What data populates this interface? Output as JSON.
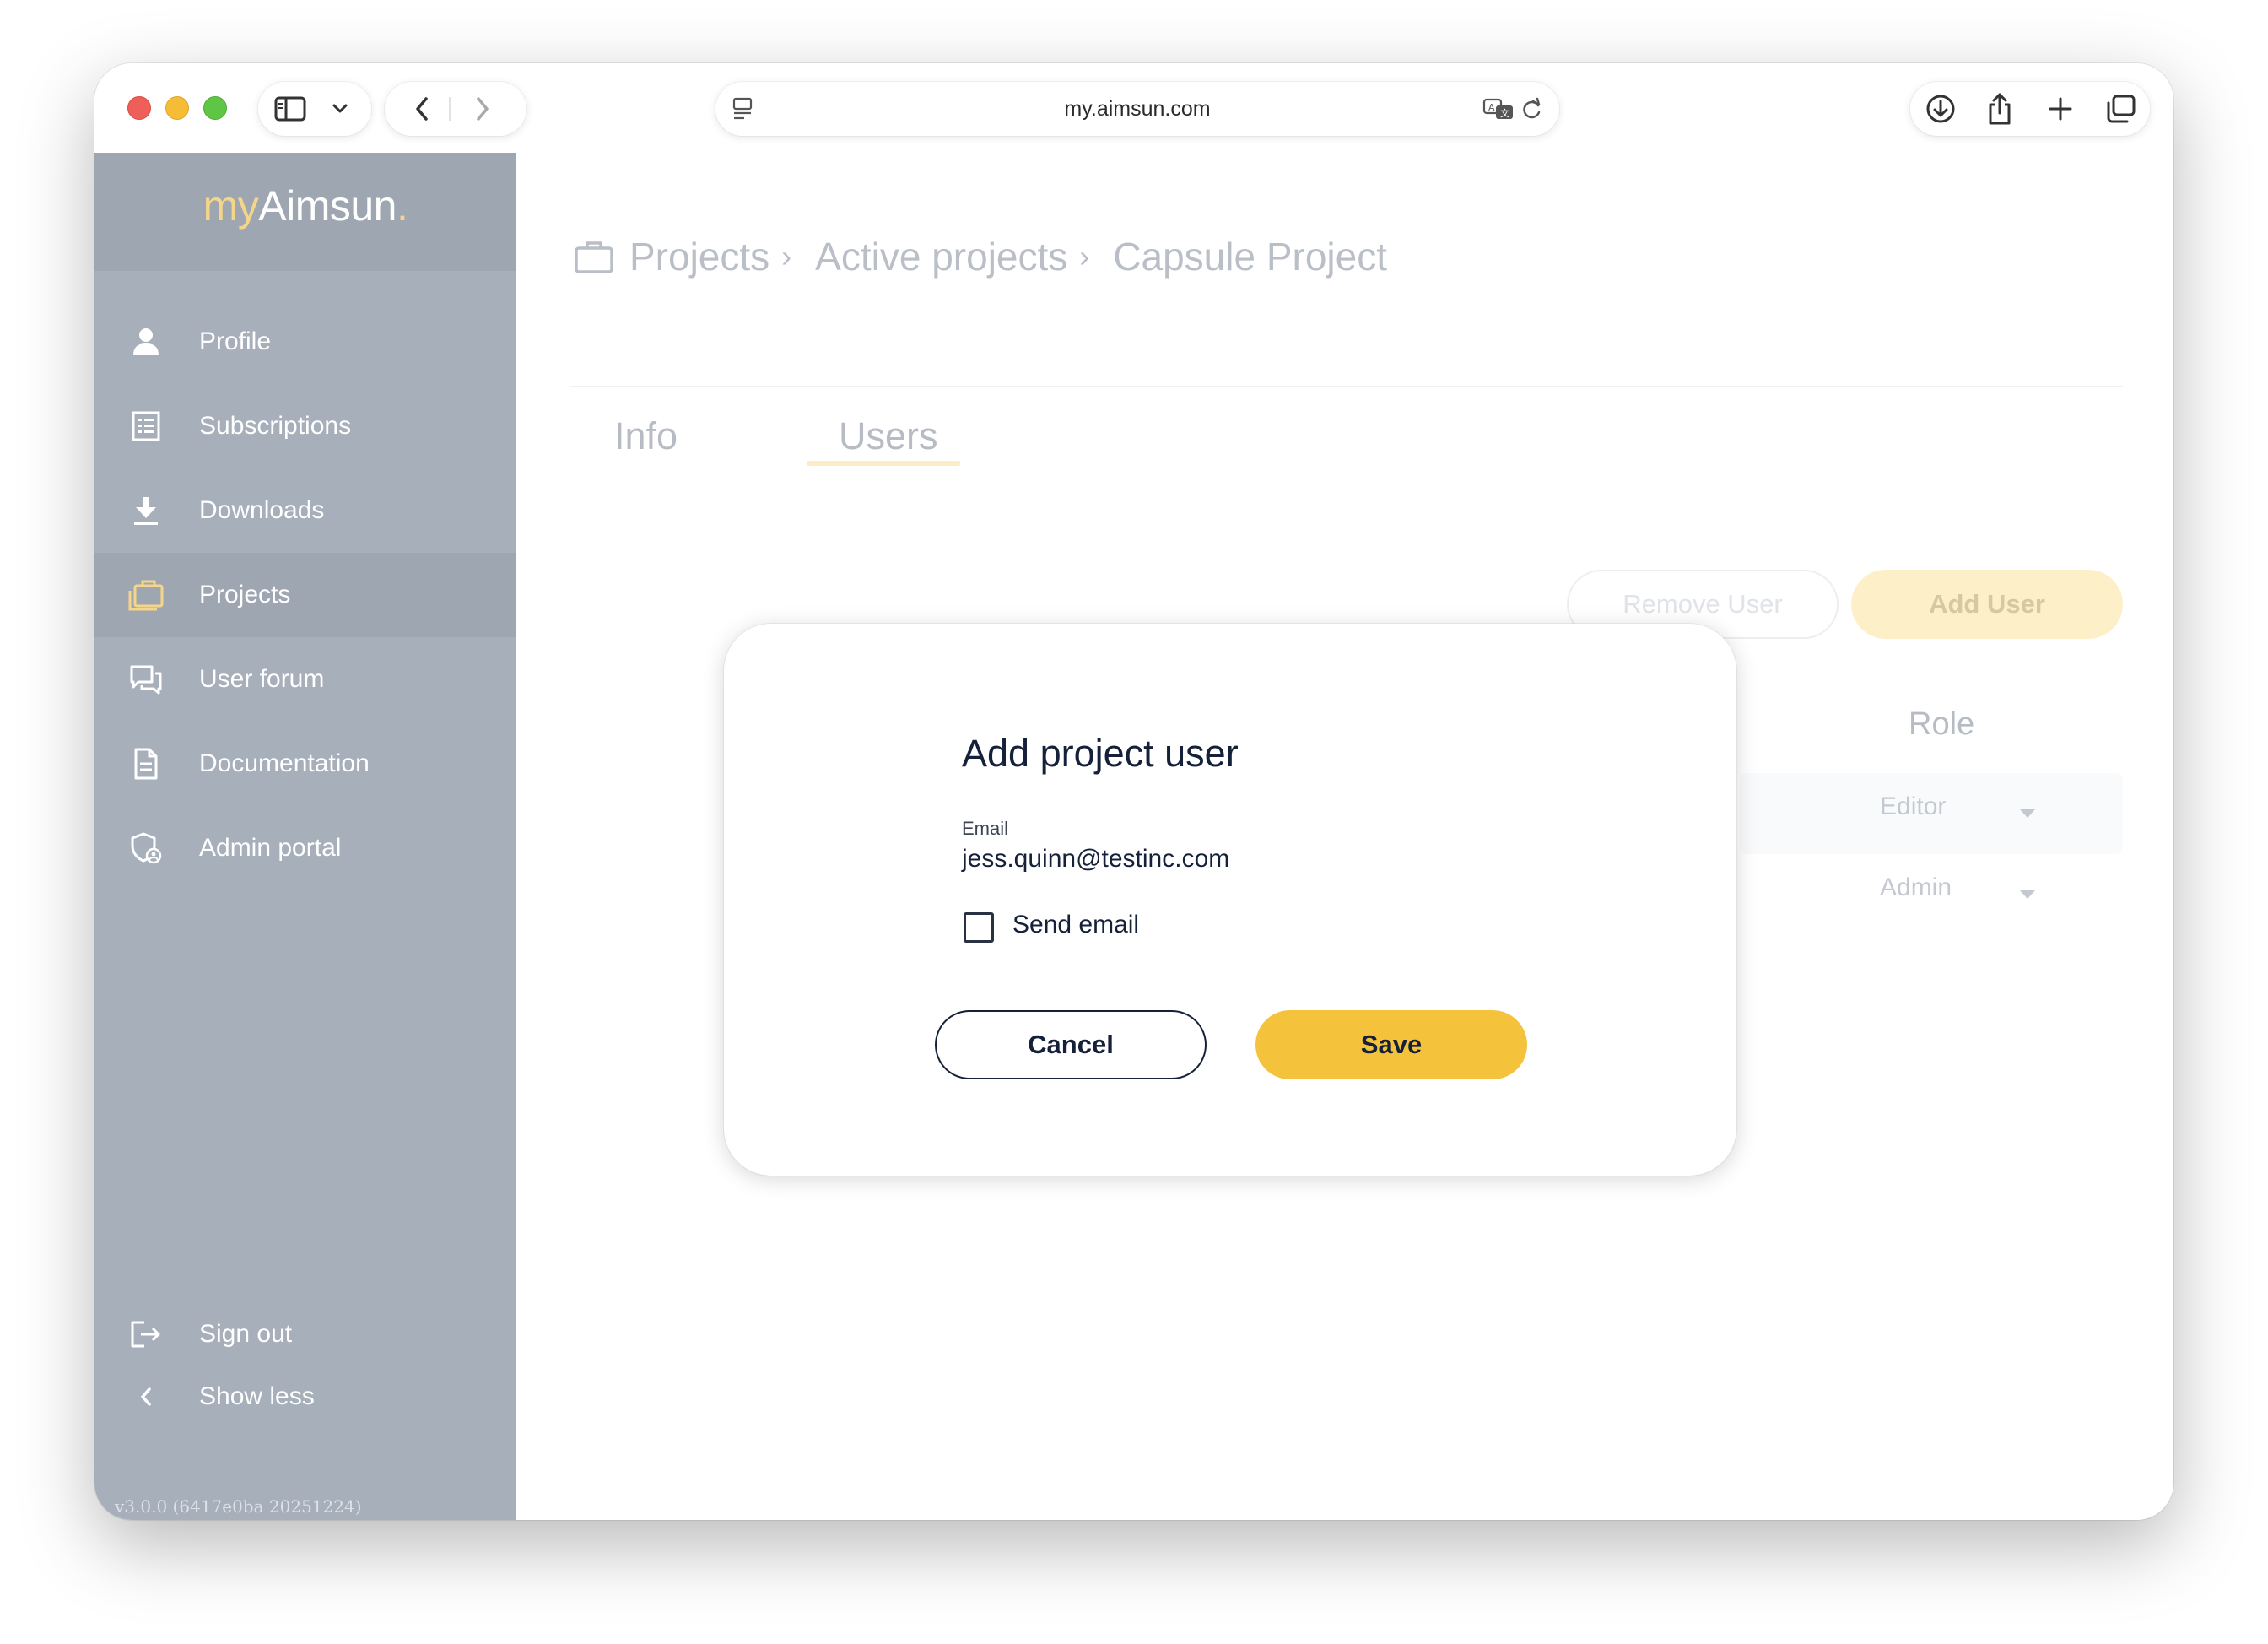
{
  "browser": {
    "url": "my.aimsun.com"
  },
  "sidebar": {
    "logo_my": "my",
    "logo_name": "Aimsun",
    "logo_dot": ".",
    "items": [
      {
        "label": "Profile",
        "icon": "person-icon"
      },
      {
        "label": "Subscriptions",
        "icon": "list-icon"
      },
      {
        "label": "Downloads",
        "icon": "download-icon"
      },
      {
        "label": "Projects",
        "icon": "briefcase-icon",
        "active": true
      },
      {
        "label": "User forum",
        "icon": "chat-icon"
      },
      {
        "label": "Documentation",
        "icon": "document-icon"
      },
      {
        "label": "Admin portal",
        "icon": "admin-shield-icon"
      }
    ],
    "bottom_items": [
      {
        "label": "Sign out",
        "icon": "sign-out-icon"
      },
      {
        "label": "Show less",
        "icon": "chevron-left-icon"
      }
    ],
    "version": "v3.0.0 (6417e0ba 20251224)"
  },
  "breadcrumb": {
    "items": [
      "Projects",
      "Active projects",
      "Capsule Project"
    ],
    "separator": "›"
  },
  "tabs": [
    {
      "label": "Info"
    },
    {
      "label": "Users",
      "active": true
    }
  ],
  "actions": {
    "remove_user": "Remove User",
    "add_user": "Add User"
  },
  "table": {
    "role_header": "Role",
    "rows": [
      {
        "role": "Editor"
      },
      {
        "role": "Admin"
      }
    ]
  },
  "dialog": {
    "title": "Add project user",
    "email_label": "Email",
    "email_value": "jess.quinn@testinc.com",
    "send_email_label": "Send email",
    "send_email_checked": false,
    "cancel": "Cancel",
    "save": "Save"
  },
  "colors": {
    "sidebar_bg": "#a7afbb",
    "accent_yellow": "#f5c33b",
    "navy_text": "#15213b"
  }
}
